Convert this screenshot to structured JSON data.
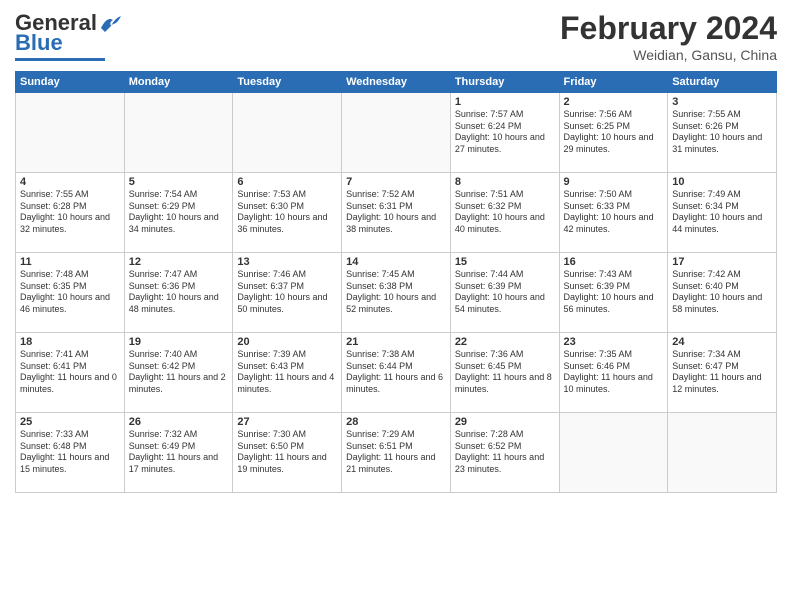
{
  "header": {
    "logo_general": "General",
    "logo_blue": "Blue",
    "month_title": "February 2024",
    "location": "Weidian, Gansu, China"
  },
  "weekdays": [
    "Sunday",
    "Monday",
    "Tuesday",
    "Wednesday",
    "Thursday",
    "Friday",
    "Saturday"
  ],
  "weeks": [
    [
      {
        "day": "",
        "empty": true
      },
      {
        "day": "",
        "empty": true
      },
      {
        "day": "",
        "empty": true
      },
      {
        "day": "",
        "empty": true
      },
      {
        "day": "1",
        "sunrise": "7:57 AM",
        "sunset": "6:24 PM",
        "daylight": "10 hours and 27 minutes."
      },
      {
        "day": "2",
        "sunrise": "7:56 AM",
        "sunset": "6:25 PM",
        "daylight": "10 hours and 29 minutes."
      },
      {
        "day": "3",
        "sunrise": "7:55 AM",
        "sunset": "6:26 PM",
        "daylight": "10 hours and 31 minutes."
      }
    ],
    [
      {
        "day": "4",
        "sunrise": "7:55 AM",
        "sunset": "6:28 PM",
        "daylight": "10 hours and 32 minutes."
      },
      {
        "day": "5",
        "sunrise": "7:54 AM",
        "sunset": "6:29 PM",
        "daylight": "10 hours and 34 minutes."
      },
      {
        "day": "6",
        "sunrise": "7:53 AM",
        "sunset": "6:30 PM",
        "daylight": "10 hours and 36 minutes."
      },
      {
        "day": "7",
        "sunrise": "7:52 AM",
        "sunset": "6:31 PM",
        "daylight": "10 hours and 38 minutes."
      },
      {
        "day": "8",
        "sunrise": "7:51 AM",
        "sunset": "6:32 PM",
        "daylight": "10 hours and 40 minutes."
      },
      {
        "day": "9",
        "sunrise": "7:50 AM",
        "sunset": "6:33 PM",
        "daylight": "10 hours and 42 minutes."
      },
      {
        "day": "10",
        "sunrise": "7:49 AM",
        "sunset": "6:34 PM",
        "daylight": "10 hours and 44 minutes."
      }
    ],
    [
      {
        "day": "11",
        "sunrise": "7:48 AM",
        "sunset": "6:35 PM",
        "daylight": "10 hours and 46 minutes."
      },
      {
        "day": "12",
        "sunrise": "7:47 AM",
        "sunset": "6:36 PM",
        "daylight": "10 hours and 48 minutes."
      },
      {
        "day": "13",
        "sunrise": "7:46 AM",
        "sunset": "6:37 PM",
        "daylight": "10 hours and 50 minutes."
      },
      {
        "day": "14",
        "sunrise": "7:45 AM",
        "sunset": "6:38 PM",
        "daylight": "10 hours and 52 minutes."
      },
      {
        "day": "15",
        "sunrise": "7:44 AM",
        "sunset": "6:39 PM",
        "daylight": "10 hours and 54 minutes."
      },
      {
        "day": "16",
        "sunrise": "7:43 AM",
        "sunset": "6:39 PM",
        "daylight": "10 hours and 56 minutes."
      },
      {
        "day": "17",
        "sunrise": "7:42 AM",
        "sunset": "6:40 PM",
        "daylight": "10 hours and 58 minutes."
      }
    ],
    [
      {
        "day": "18",
        "sunrise": "7:41 AM",
        "sunset": "6:41 PM",
        "daylight": "11 hours and 0 minutes."
      },
      {
        "day": "19",
        "sunrise": "7:40 AM",
        "sunset": "6:42 PM",
        "daylight": "11 hours and 2 minutes."
      },
      {
        "day": "20",
        "sunrise": "7:39 AM",
        "sunset": "6:43 PM",
        "daylight": "11 hours and 4 minutes."
      },
      {
        "day": "21",
        "sunrise": "7:38 AM",
        "sunset": "6:44 PM",
        "daylight": "11 hours and 6 minutes."
      },
      {
        "day": "22",
        "sunrise": "7:36 AM",
        "sunset": "6:45 PM",
        "daylight": "11 hours and 8 minutes."
      },
      {
        "day": "23",
        "sunrise": "7:35 AM",
        "sunset": "6:46 PM",
        "daylight": "11 hours and 10 minutes."
      },
      {
        "day": "24",
        "sunrise": "7:34 AM",
        "sunset": "6:47 PM",
        "daylight": "11 hours and 12 minutes."
      }
    ],
    [
      {
        "day": "25",
        "sunrise": "7:33 AM",
        "sunset": "6:48 PM",
        "daylight": "11 hours and 15 minutes."
      },
      {
        "day": "26",
        "sunrise": "7:32 AM",
        "sunset": "6:49 PM",
        "daylight": "11 hours and 17 minutes."
      },
      {
        "day": "27",
        "sunrise": "7:30 AM",
        "sunset": "6:50 PM",
        "daylight": "11 hours and 19 minutes."
      },
      {
        "day": "28",
        "sunrise": "7:29 AM",
        "sunset": "6:51 PM",
        "daylight": "11 hours and 21 minutes."
      },
      {
        "day": "29",
        "sunrise": "7:28 AM",
        "sunset": "6:52 PM",
        "daylight": "11 hours and 23 minutes."
      },
      {
        "day": "",
        "empty": true
      },
      {
        "day": "",
        "empty": true
      }
    ]
  ]
}
